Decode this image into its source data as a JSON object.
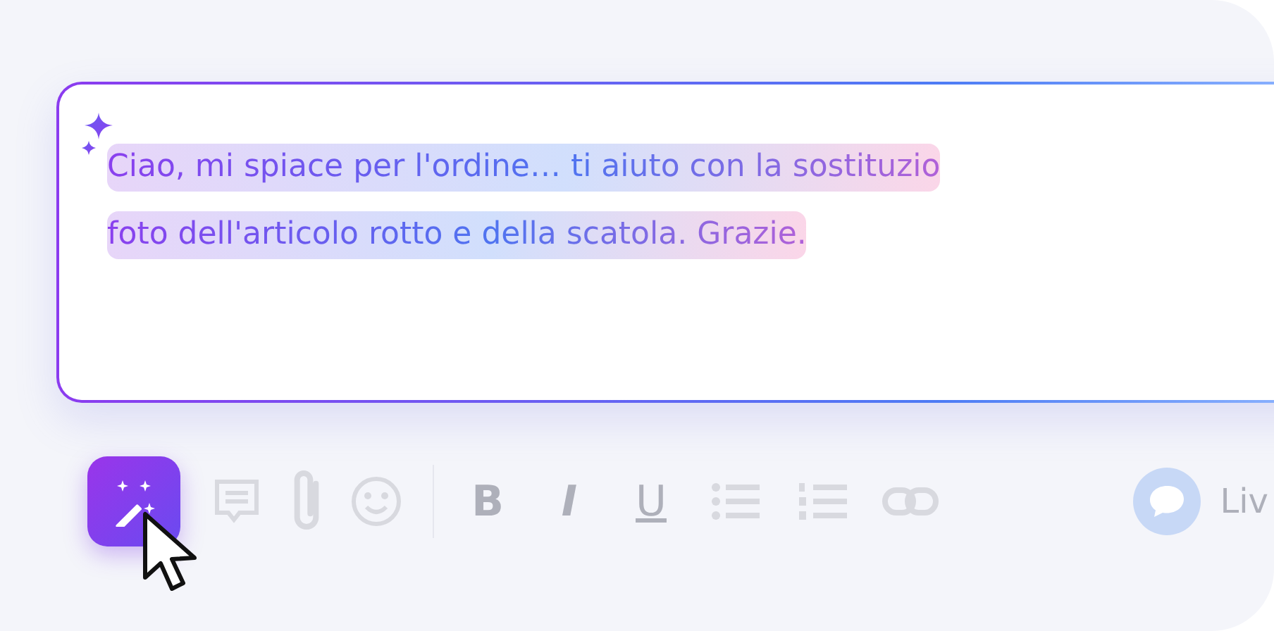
{
  "editor": {
    "lines": [
      "Ciao, mi spiace per l'ordine… ti aiuto con la sostituzio",
      "foto dell'articolo rotto e della scatola. Grazie."
    ]
  },
  "toolbar": {
    "items": [
      {
        "kind": "magic",
        "active": true
      },
      {
        "kind": "comment",
        "active": false
      },
      {
        "kind": "attach",
        "active": false
      },
      {
        "kind": "emoji",
        "active": false
      },
      {
        "kind": "divider"
      },
      {
        "kind": "bold",
        "label": "B",
        "active": false
      },
      {
        "kind": "italic",
        "label": "I",
        "active": false
      },
      {
        "kind": "underline",
        "label": "U",
        "active": false
      },
      {
        "kind": "bullets",
        "active": false
      },
      {
        "kind": "numbers",
        "active": false
      },
      {
        "kind": "link",
        "active": false
      }
    ]
  },
  "channel": {
    "label": "Liv"
  }
}
